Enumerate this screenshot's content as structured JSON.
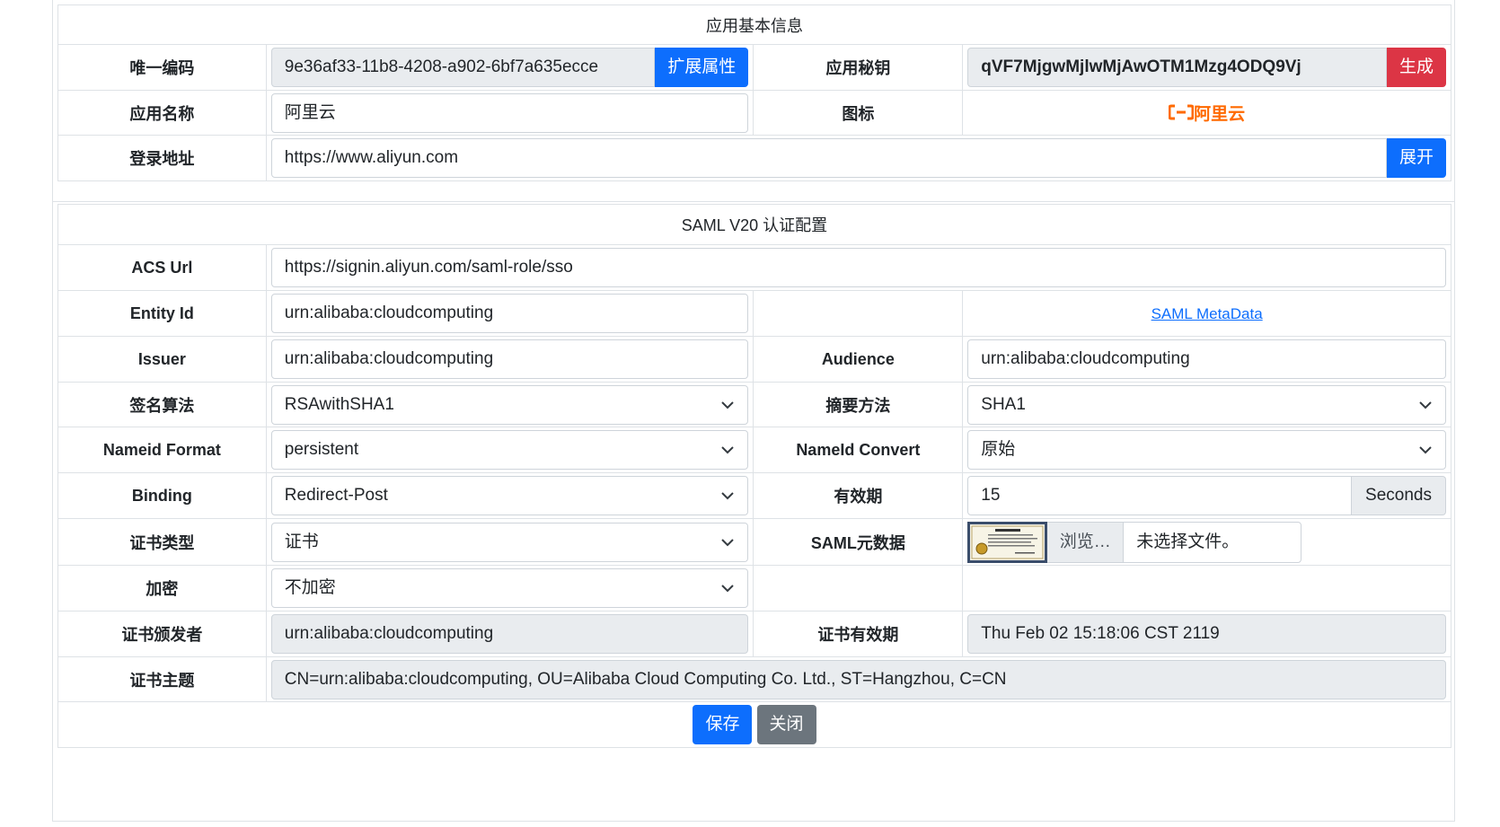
{
  "basic": {
    "title": "应用基本信息",
    "uid_label": "唯一编码",
    "uid_value": "9e36af33-11b8-4208-a902-6bf7a635ecce",
    "ext_button": "扩展属性",
    "secret_label": "应用秘钥",
    "secret_value": "qVF7MjgwMjlwMjAwOTM1Mzg4ODQ9Vj",
    "gen_button": "生成",
    "name_label": "应用名称",
    "name_value": "阿里云",
    "icon_label": "图标",
    "logo_text": "阿里云",
    "logo_color": "#ff6a00",
    "login_label": "登录地址",
    "login_value": "https://www.aliyun.com",
    "expand_button": "展开"
  },
  "saml": {
    "title": "SAML V20 认证配置",
    "acs_label": "ACS Url",
    "acs_value": "https://signin.aliyun.com/saml-role/sso",
    "entity_label": "Entity Id",
    "entity_value": "urn:alibaba:cloudcomputing",
    "metadata_link": "SAML MetaData",
    "issuer_label": "Issuer",
    "issuer_value": "urn:alibaba:cloudcomputing",
    "audience_label": "Audience",
    "audience_value": "urn:alibaba:cloudcomputing",
    "sign_label": "签名算法",
    "sign_value": "RSAwithSHA1",
    "digest_label": "摘要方法",
    "digest_value": "SHA1",
    "nameid_format_label": "Nameid Format",
    "nameid_format_value": "persistent",
    "nameid_convert_label": "NameId Convert",
    "nameid_convert_value": "原始",
    "binding_label": "Binding",
    "binding_value": "Redirect-Post",
    "validity_label": "有效期",
    "validity_value": "15",
    "validity_unit": "Seconds",
    "cert_type_label": "证书类型",
    "cert_type_value": "证书",
    "metadata_label": "SAML元数据",
    "browse_label": "浏览…",
    "file_status": "未选择文件。",
    "encrypt_label": "加密",
    "encrypt_value": "不加密",
    "cert_issuer_label": "证书颁发者",
    "cert_issuer_value": "urn:alibaba:cloudcomputing",
    "cert_expiry_label": "证书有效期",
    "cert_expiry_value": "Thu Feb 02 15:18:06 CST 2119",
    "cert_subject_label": "证书主题",
    "cert_subject_value": "CN=urn:alibaba:cloudcomputing, OU=Alibaba Cloud Computing Co. Ltd., ST=Hangzhou, C=CN"
  },
  "actions": {
    "save_button": "保存",
    "close_button": "关闭"
  },
  "colors": {
    "primary": "#0d6efd",
    "danger": "#dc3545",
    "secondary": "#6c757d"
  }
}
